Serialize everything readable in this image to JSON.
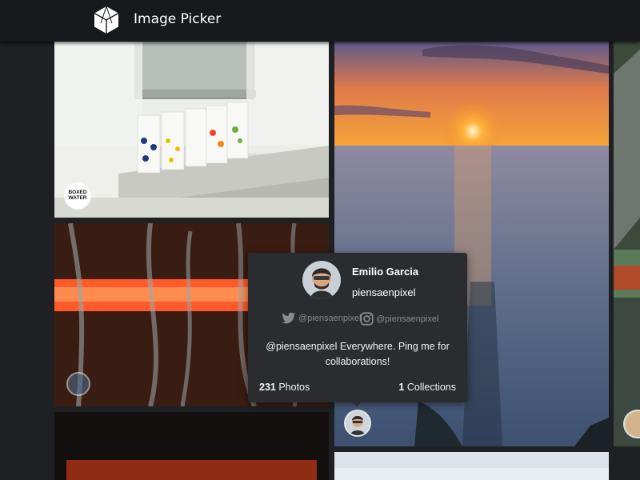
{
  "app": {
    "title": "Image Picker",
    "logo_icon": "hexagon-logo-icon"
  },
  "tiles": [
    {
      "name": "photo-boxed-water",
      "badge_text": "BOXED WATER"
    },
    {
      "name": "photo-sunset-lake"
    },
    {
      "name": "photo-red-drops"
    },
    {
      "name": "photo-mountain-edge"
    },
    {
      "name": "photo-dark-bottom"
    },
    {
      "name": "photo-sky-bottom"
    }
  ],
  "popover": {
    "name": "Emilio Garcia",
    "username": "piensaenpixel",
    "twitter": "@piensaenpixel",
    "instagram": "@piensaenpixel",
    "bio": "@piensaenpixel Everywhere. Ping me for collaborations!",
    "photos_count": "231",
    "photos_label": "Photos",
    "collections_count": "1",
    "collections_label": "Collections"
  },
  "colors": {
    "background": "#1f2023",
    "topbar": "#18191c",
    "popover": "#2b2c30"
  }
}
